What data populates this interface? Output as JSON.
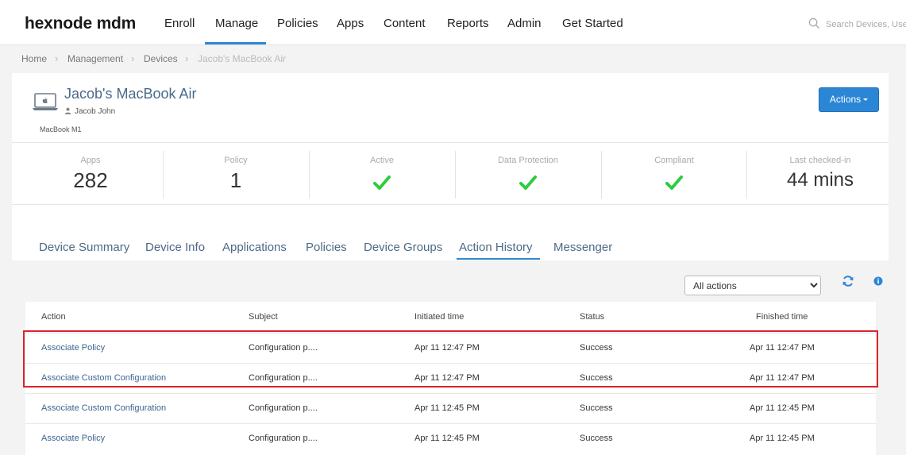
{
  "brand": "hexnode mdm",
  "nav": {
    "items": [
      "Enroll",
      "Manage",
      "Policies",
      "Apps",
      "Content",
      "Reports",
      "Admin",
      "Get Started"
    ],
    "active": "Manage"
  },
  "search": {
    "placeholder": "Search Devices, Users"
  },
  "breadcrumb": [
    "Home",
    "Management",
    "Devices",
    "Jacob's MacBook Air"
  ],
  "device": {
    "name": "Jacob's MacBook Air",
    "user": "Jacob John",
    "model": "MacBook M1"
  },
  "actions_label": "Actions",
  "stats": [
    {
      "label": "Apps",
      "value": "282"
    },
    {
      "label": "Policy",
      "value": "1"
    },
    {
      "label": "Active",
      "value": "",
      "icon": "green-check-icon"
    },
    {
      "label": "Data Protection",
      "value": "",
      "icon": "green-check-icon"
    },
    {
      "label": "Compliant",
      "value": "",
      "icon": "green-check-icon"
    },
    {
      "label": "Last checked-in",
      "value": "44 mins"
    }
  ],
  "tabs": [
    "Device Summary",
    "Device Info",
    "Applications",
    "Policies",
    "Device Groups",
    "Action History",
    "Messenger"
  ],
  "active_tab": "Action History",
  "filter": {
    "selected": "All actions"
  },
  "table": {
    "headers": [
      "Action",
      "Subject",
      "Initiated time",
      "Status",
      "Finished time"
    ],
    "rows": [
      [
        "Associate Policy",
        "Configuration p....",
        "Apr 11 12:47 PM",
        "Success",
        "Apr 11 12:47 PM"
      ],
      [
        "Associate Custom Configuration",
        "Configuration p....",
        "Apr 11 12:47 PM",
        "Success",
        "Apr 11 12:47 PM"
      ],
      [
        "Associate Custom Configuration",
        "Configuration p....",
        "Apr 11 12:45 PM",
        "Success",
        "Apr 11 12:45 PM"
      ],
      [
        "Associate Policy",
        "Configuration p....",
        "Apr 11 12:45 PM",
        "Success",
        "Apr 11 12:45 PM"
      ]
    ]
  },
  "colors": {
    "accent": "#2f86d6",
    "highlight": "#d9232d",
    "check": "#2ecc40",
    "link": "#3e6591"
  }
}
